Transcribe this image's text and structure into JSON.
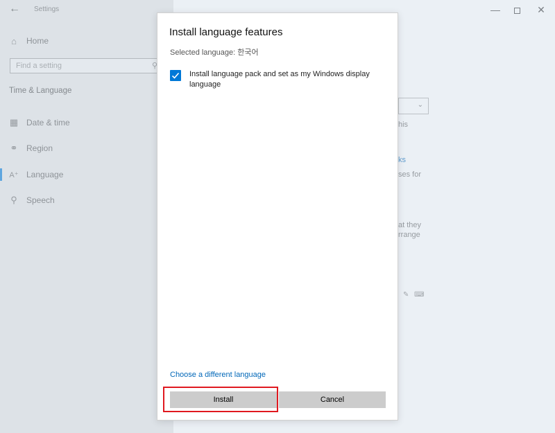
{
  "window": {
    "title": "Settings",
    "back_icon": "back-arrow-icon",
    "minimize": "—",
    "close": "✕"
  },
  "sidebar": {
    "home_label": "Home",
    "search_placeholder": "Find a setting",
    "section_title": "Time & Language",
    "items": [
      {
        "label": "Date & time",
        "icon": "calendar-clock-icon"
      },
      {
        "label": "Region",
        "icon": "globe-icon"
      },
      {
        "label": "Language",
        "icon": "language-icon"
      },
      {
        "label": "Speech",
        "icon": "microphone-icon"
      }
    ],
    "active_item": "Language",
    "accent": "#0078d7"
  },
  "background_content": {
    "fragments": [
      "his",
      "ks",
      "ses for",
      "at they",
      "rrange"
    ]
  },
  "dialog": {
    "title": "Install language features",
    "selected_language": "Selected language: 한국어",
    "checkbox_label": "Install language pack and set as my Windows display language",
    "checkbox_checked": true,
    "different_language_link": "Choose a different language",
    "install_label": "Install",
    "cancel_label": "Cancel"
  },
  "colors": {
    "highlight_border": "#e0181f",
    "link": "#0067b8",
    "button_bg": "#cccccc"
  }
}
